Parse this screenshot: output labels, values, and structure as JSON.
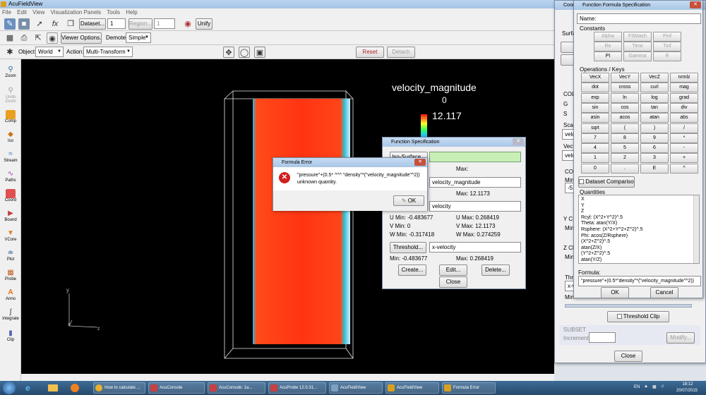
{
  "app": {
    "title": "AcuFieldView",
    "menus": [
      "File",
      "Edit",
      "View",
      "Visualization Panels",
      "Tools",
      "Help"
    ]
  },
  "toolbar1": {
    "dataset_label": "Dataset...",
    "dataset_value": "1",
    "region_label": "Region...",
    "region_value": "1",
    "unify_label": "Unify"
  },
  "toolbar2": {
    "viewer_options_label": "Viewer Options...",
    "demote_label": "Demote:",
    "demote_value": "Simple"
  },
  "toolbar3": {
    "object_label": "Object:",
    "object_value": "World",
    "action_label": "Action:",
    "action_value": "Multi-Transform",
    "reset_label": "Reset",
    "detach_label": "Detach"
  },
  "leftbar": [
    "Zoom",
    "Undo Zoom",
    "Comp",
    "Iso",
    "Stream",
    "Paths",
    "Coord",
    "Bound",
    "VCore",
    "Plot",
    "Probe",
    "Anno",
    "Integrate",
    "Clip"
  ],
  "viewport": {
    "legend_title": "velocity_magnitude",
    "legend_min": "0",
    "legend_max": "12.117",
    "axis_y": "y",
    "axis_x": "x",
    "axis_z": "z",
    "colors": {
      "background": "#000000",
      "field": "#ff3a14"
    }
  },
  "function_spec": {
    "title": "Function Specification",
    "iso_surface_label": "Iso-Surface...",
    "max_label": "Max:",
    "color_field": "velocity_magnitude",
    "color_max": "Max: 12.1173",
    "vector_field": "velocity",
    "u_min": "U Min: -0.483677",
    "u_max": "U Max: 0.268419",
    "v_min": "V Min: 0",
    "v_max": "V Max: 12.1173",
    "w_min": "W Min: -0.317418",
    "w_max": "W Max: 0.274259",
    "threshold_label": "Threshold...",
    "threshold_field": "x-velocity",
    "th_min": "Min: -0.483677",
    "th_max": "Max: 0.268419",
    "create_label": "Create...",
    "edit_label": "Edit...",
    "delete_label": "Delete...",
    "close_label": "Close"
  },
  "formula_error": {
    "title": "Formula Error",
    "message_line1": "\"pressure\"+(0.5* ^^^ \"density\"*(\"velocity_magnitude\"^2))",
    "message_line2": "unknown quantity.",
    "ok_label": "OK"
  },
  "coord_panel": {
    "title": "Coor",
    "surface_tab": "Surfa",
    "labels": [
      "COL",
      "G",
      "S",
      "Scal",
      "velo",
      "Vect",
      "velo",
      "COO",
      "Min",
      "-5",
      "Y CL",
      "Min",
      "Z CL",
      "Min",
      "Thre",
      "x-v",
      "Min"
    ],
    "threshold_clip": "Threshold Clip",
    "subset": "SUBSET",
    "increment_label": "Increment:",
    "modify_label": "Modify...",
    "close_label": "Close"
  },
  "formula_spec": {
    "title": "Function Formula Specification",
    "name_label": "Name:",
    "constants_label": "Constants",
    "constants": [
      "Alpha",
      "FSMach",
      "Pinf",
      "Re",
      "Time",
      "Tinf",
      "PI",
      "Gamma",
      "R"
    ],
    "operations_label": "Operations / Keys",
    "keys": [
      "VecX",
      "VecY",
      "VecZ",
      "nrmlz",
      "dot",
      "cross",
      "curl",
      "mag",
      "exp",
      "ln",
      "log",
      "grad",
      "sin",
      "cos",
      "tan",
      "div",
      "asin",
      "acos",
      "atan",
      "abs",
      "sqrt",
      "(",
      ")",
      "/",
      "7",
      "8",
      "9",
      "*",
      "4",
      "5",
      "6",
      "-",
      "1",
      "2",
      "3",
      "+",
      "0",
      ".",
      "E",
      "^"
    ],
    "dataset_comparison": "Dataset Comparison",
    "quantities_label": "Quantities",
    "quantities": [
      "X",
      "Y",
      "Z",
      "Rcyl: (X^2+Y^2)^.5",
      "Theta: atan(Y/X)",
      "Rsphere: (X^2+Y^2+Z^2)^.5",
      "Phi: acos(Z/Rsphere)",
      "(X^2+Z^2)^.5",
      "atan(Z/X)",
      "(Y^2+Z^2)^.5",
      "atan(Y/Z)"
    ],
    "formula_label": "Formula:",
    "formula_value": "\"pressure\"+(0.5*\"density\"*(\"velocity_magnitude\"^2))",
    "ok_label": "OK",
    "cancel_label": "Cancel"
  },
  "taskbar": {
    "tasks": [
      "How to calculate ...",
      "AcuConsole",
      "AcuConsole: 1a...",
      "AcuProbe 12.0.31...",
      "AcuFieldView",
      "AcuFieldView",
      "Formula Error"
    ],
    "lang": "EN",
    "time": "18:12",
    "date": "20/07/2015"
  }
}
